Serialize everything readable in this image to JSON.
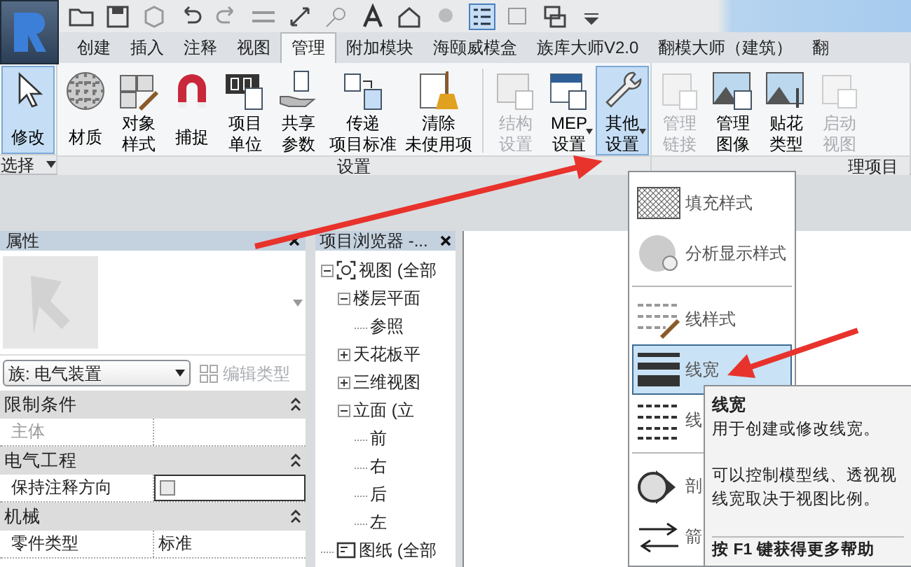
{
  "tabs": [
    {
      "label": "创建",
      "selected": false
    },
    {
      "label": "插入",
      "selected": false
    },
    {
      "label": "注释",
      "selected": false
    },
    {
      "label": "视图",
      "selected": false
    },
    {
      "label": "管理",
      "selected": true
    },
    {
      "label": "附加模块",
      "selected": false
    },
    {
      "label": "海颐威模盒",
      "selected": false
    },
    {
      "label": "族库大师V2.0",
      "selected": false
    },
    {
      "label": "翻模大师（建筑）",
      "selected": false
    },
    {
      "label": "翻",
      "selected": false
    }
  ],
  "ribbon": {
    "panels": [
      {
        "title": "选择",
        "has_menu": true,
        "buttons": [
          {
            "label_lines": [
              "修改"
            ],
            "selected": true,
            "disabled": false,
            "dropdown": false
          }
        ]
      },
      {
        "title": "设置",
        "has_menu": false,
        "buttons": [
          {
            "label_lines": [
              "材质"
            ],
            "selected": false,
            "disabled": false,
            "dropdown": false
          },
          {
            "label_lines": [
              "对象",
              "样式"
            ],
            "selected": false,
            "disabled": false,
            "dropdown": false
          },
          {
            "label_lines": [
              "捕捉"
            ],
            "selected": false,
            "disabled": false,
            "dropdown": false
          },
          {
            "label_lines": [
              "项目",
              "单位"
            ],
            "selected": false,
            "disabled": false,
            "dropdown": false
          },
          {
            "label_lines": [
              "共享",
              "参数"
            ],
            "selected": false,
            "disabled": false,
            "dropdown": false
          },
          {
            "label_lines": [
              "传递",
              "项目标准"
            ],
            "selected": false,
            "disabled": false,
            "dropdown": false
          },
          {
            "label_lines": [
              "清除",
              "未使用项"
            ],
            "selected": false,
            "disabled": false,
            "dropdown": false
          },
          {
            "label_lines": [
              "结构",
              "设置"
            ],
            "selected": false,
            "disabled": true,
            "dropdown": false
          },
          {
            "label_lines": [
              "MEP",
              "设置"
            ],
            "selected": false,
            "disabled": false,
            "dropdown": true
          },
          {
            "label_lines": [
              "其他",
              "设置"
            ],
            "selected": true,
            "disabled": false,
            "dropdown": true
          }
        ]
      },
      {
        "title": "理项目",
        "has_menu": false,
        "buttons": [
          {
            "label_lines": [
              "管理",
              "链接"
            ],
            "selected": false,
            "disabled": true,
            "dropdown": false
          },
          {
            "label_lines": [
              "管理",
              "图像"
            ],
            "selected": false,
            "disabled": false,
            "dropdown": false
          },
          {
            "label_lines": [
              "贴花",
              "类型"
            ],
            "selected": false,
            "disabled": false,
            "dropdown": false
          },
          {
            "label_lines": [
              "启动",
              "视图"
            ],
            "selected": false,
            "disabled": true,
            "dropdown": false
          }
        ]
      }
    ]
  },
  "properties": {
    "title": "属性",
    "type_selector": "族: 电气装置",
    "edit_type": {
      "label": "编辑类型",
      "disabled": true
    },
    "sections": [
      {
        "title": "限制条件",
        "rows": [
          {
            "kind": "text",
            "label": "主体",
            "value": "",
            "disabled": true
          }
        ]
      },
      {
        "title": "电气工程",
        "rows": [
          {
            "kind": "checkbox",
            "label": "保持注释方向",
            "checked": false,
            "disabled": false
          }
        ]
      },
      {
        "title": "机械",
        "rows": [
          {
            "kind": "text",
            "label": "零件类型",
            "value": "标准",
            "disabled": false
          }
        ]
      }
    ]
  },
  "browser": {
    "title": "项目浏览器 -...",
    "tree": [
      {
        "label": "视图 (全部",
        "expanded": true,
        "children": [
          {
            "label": "楼层平面",
            "expanded": true,
            "children": [
              {
                "label": "参照"
              }
            ]
          },
          {
            "label": "天花板平",
            "expanded": false
          },
          {
            "label": "三维视图",
            "expanded": false
          },
          {
            "label": "立面 (立",
            "expanded": true,
            "children": [
              {
                "label": "前"
              },
              {
                "label": "右"
              },
              {
                "label": "后"
              },
              {
                "label": "左"
              }
            ]
          }
        ]
      },
      {
        "label": "图纸 (全部"
      }
    ]
  },
  "menu": {
    "groups": [
      [
        {
          "label": "填充样式",
          "selected": false
        },
        {
          "label": "分析显示样式",
          "selected": false
        }
      ],
      [
        {
          "label": "线样式",
          "selected": false
        },
        {
          "label": "线宽",
          "selected": true
        },
        {
          "label": "线",
          "selected": false
        }
      ],
      [
        {
          "label": "剖",
          "selected": false
        },
        {
          "label": "箭",
          "selected": false
        }
      ]
    ]
  },
  "tooltip": {
    "title": "线宽",
    "paragraphs": [
      "用于创建或修改线宽。",
      "可以控制模型线、透视视",
      "线宽取决于视图比例。"
    ],
    "footer": "按 F1 键获得更多帮助"
  }
}
